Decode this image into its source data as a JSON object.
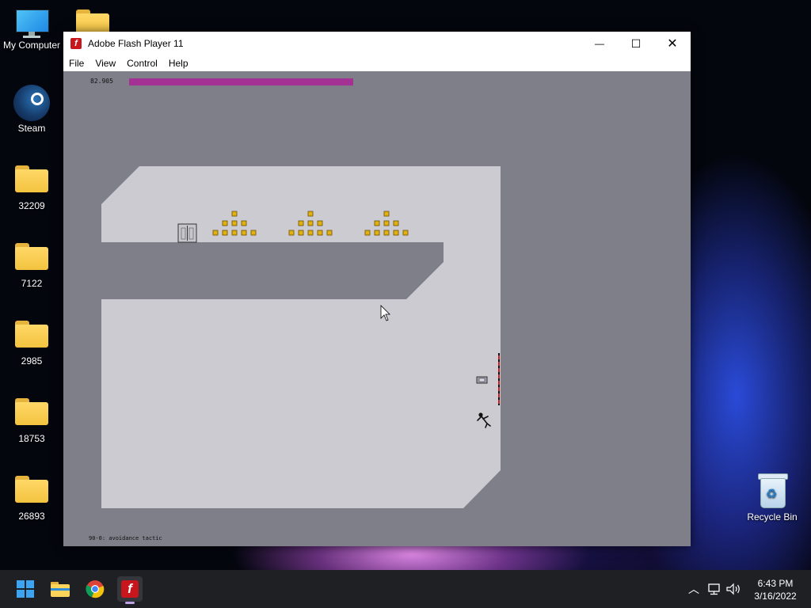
{
  "desktop": {
    "icons": [
      {
        "label": "My Computer"
      },
      {
        "label": "Steam"
      },
      {
        "label": "32209"
      },
      {
        "label": "7122"
      },
      {
        "label": "2985"
      },
      {
        "label": "18753"
      },
      {
        "label": "26893"
      },
      {
        "label": "Recycle Bin"
      }
    ]
  },
  "window": {
    "title": "Adobe Flash Player 11",
    "app_icon_glyph": "f",
    "menu": [
      "File",
      "View",
      "Control",
      "Help"
    ],
    "buttons": {
      "minimize": "—",
      "maximize": "☐",
      "close": "✕"
    }
  },
  "game": {
    "time_remaining_text": "82.905",
    "time_bar_color": "#a33294",
    "time_remaining_fraction": 0.48,
    "level_name": "90-0: avoidance tactic",
    "colors": {
      "background": "#7e7f89",
      "floor": "#cbcbd1",
      "gold": "#e2b00f",
      "door": "#c6c6cc"
    }
  },
  "taskbar": {
    "pinned": [
      "start-icon",
      "file-explorer-icon",
      "chrome-icon",
      "flash-player-icon"
    ],
    "clock_time": "6:43 PM",
    "clock_date": "3/16/2022"
  }
}
